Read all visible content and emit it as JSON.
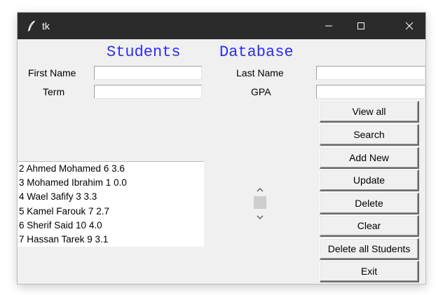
{
  "window": {
    "title": "tk",
    "controls": {
      "minimize": "minimize-icon",
      "maximize": "maximize-icon",
      "close": "close-icon"
    }
  },
  "heading": {
    "part1": "Students",
    "part2": "Database",
    "color": "#2d2df0"
  },
  "form": {
    "first_name_label": "First Name",
    "last_name_label": "Last Name",
    "term_label": "Term",
    "gpa_label": "GPA",
    "first_name_value": "",
    "last_name_value": "",
    "term_value": "",
    "gpa_value": ""
  },
  "students": [
    "2 Ahmed Mohamed 6 3.6",
    "3 Mohamed Ibrahim 1 0.0",
    "4 Wael 3afify 3 3.3",
    "5 Kamel Farouk 7 2.7",
    "6 Sherif Said 10 4.0",
    "7 Hassan Tarek 9 3.1"
  ],
  "buttons": {
    "view_all": "View all",
    "search": "Search",
    "add_new": "Add New",
    "update": "Update",
    "delete": "Delete",
    "clear": "Clear",
    "delete_all": "Delete all Students",
    "exit": "Exit"
  }
}
